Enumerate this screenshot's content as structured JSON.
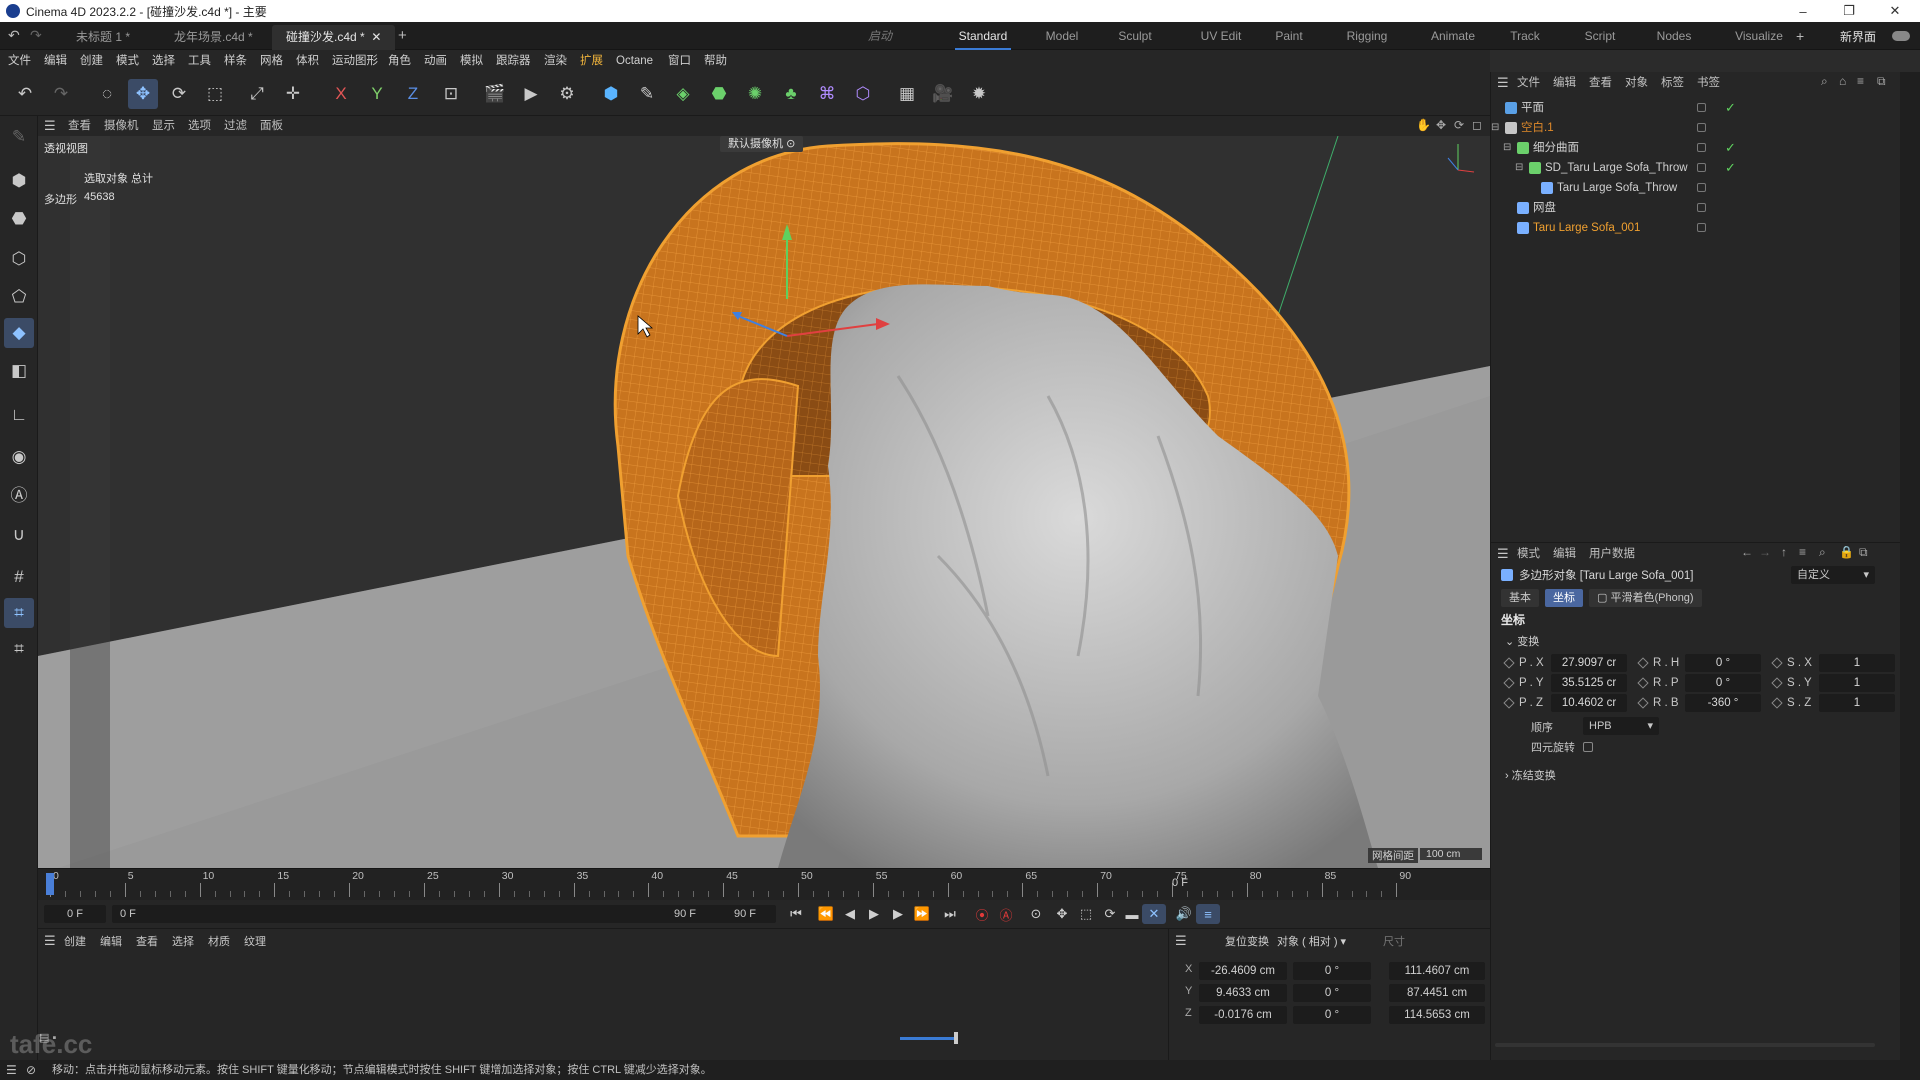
{
  "app": {
    "title": "Cinema 4D 2023.2.2 - [碰撞沙发.c4d *] - 主要"
  },
  "doc_tabs": [
    "未标题 1 *",
    "龙年场景.c4d *",
    "碰撞沙发.c4d *"
  ],
  "layout_label": "启动",
  "layouts": [
    "Standard",
    "Model",
    "Sculpt",
    "UV Edit",
    "Paint",
    "Rigging",
    "Animate",
    "Track",
    "Script",
    "Nodes",
    "Visualize"
  ],
  "layout_active": "Standard",
  "new_interface": "新界面",
  "menu": [
    "文件",
    "编辑",
    "创建",
    "模式",
    "选择",
    "工具",
    "样条",
    "网格",
    "体积",
    "运动图形",
    "角色",
    "动画",
    "模拟",
    "跟踪器",
    "渲染",
    "扩展",
    "Octane",
    "窗口",
    "帮助"
  ],
  "axis_buttons": [
    "X",
    "Y",
    "Z"
  ],
  "viewport": {
    "menu": [
      "查看",
      "摄像机",
      "显示",
      "选项",
      "过滤",
      "面板"
    ],
    "view_name": "透视视图",
    "camera": "默认摄像机",
    "stats_header": "选取对象 总计",
    "stats_label": "多边形",
    "stats_value": "45638",
    "grid_label": "网格间距",
    "grid_value": "100 cm"
  },
  "timeline": {
    "ticks": [
      "0",
      "5",
      "10",
      "15",
      "20",
      "25",
      "30",
      "35",
      "40",
      "45",
      "50",
      "55",
      "60",
      "65",
      "70",
      "75",
      "80",
      "85",
      "90"
    ],
    "current_frame": "0 F"
  },
  "transport": {
    "start_field": "0 F",
    "range_start": "0 F",
    "range_end": "90 F",
    "end_field": "90 F"
  },
  "material_menu": [
    "创建",
    "编辑",
    "查看",
    "选择",
    "材质",
    "纹理"
  ],
  "coords": {
    "reset_label": "复位变换",
    "mode": "对象 ( 相对 )",
    "size_label": "尺寸",
    "rows": [
      {
        "axis": "X",
        "pos": "-26.4609 cm",
        "rot": "0 °",
        "size": "111.4607 cm"
      },
      {
        "axis": "Y",
        "pos": "9.4633 cm",
        "rot": "0 °",
        "size": "87.4451 cm"
      },
      {
        "axis": "Z",
        "pos": "-0.0176 cm",
        "rot": "0 °",
        "size": "114.5653 cm"
      }
    ]
  },
  "object_manager": {
    "menu": [
      "文件",
      "编辑",
      "查看",
      "对象",
      "标签",
      "书签"
    ],
    "items": [
      {
        "name": "平面",
        "indent": 0,
        "color": "#d0d0d0",
        "icon": "#5aa0e6",
        "check": true
      },
      {
        "name": "空白.1",
        "indent": 0,
        "color": "#e08a2a",
        "icon": "#c6c6c6",
        "check": false
      },
      {
        "name": "细分曲面",
        "indent": 1,
        "color": "#d0d0d0",
        "icon": "#6bd06b",
        "check": true
      },
      {
        "name": "SD_Taru Large Sofa_Throw",
        "indent": 2,
        "color": "#d0d0d0",
        "icon": "#6bd06b",
        "check": true
      },
      {
        "name": "Taru Large Sofa_Throw",
        "indent": 3,
        "color": "#d0d0d0",
        "icon": "#7ab0ff",
        "check": false
      },
      {
        "name": "网盘",
        "indent": 1,
        "color": "#d0d0d0",
        "icon": "#7ab0ff",
        "check": false
      },
      {
        "name": "Taru Large Sofa_001",
        "indent": 1,
        "color": "#f0a030",
        "icon": "#7ab0ff",
        "check": false
      }
    ]
  },
  "attributes": {
    "menu": [
      "模式",
      "编辑",
      "用户数据"
    ],
    "object_title": "多边形对象 [Taru Large Sofa_001]",
    "preset": "自定义",
    "tabs": [
      "基本",
      "坐标",
      "平滑着色(Phong)"
    ],
    "active_tab": "坐标",
    "section": "坐标",
    "group": "变换",
    "pos": [
      {
        "label": "P . X",
        "value": "27.9097 cr"
      },
      {
        "label": "P . Y",
        "value": "35.5125 cr"
      },
      {
        "label": "P . Z",
        "value": "10.4602 cr"
      }
    ],
    "rot": [
      {
        "label": "R . H",
        "value": "0 °"
      },
      {
        "label": "R . P",
        "value": "0 °"
      },
      {
        "label": "R . B",
        "value": "-360 °"
      }
    ],
    "scale": [
      {
        "label": "S . X",
        "value": "1"
      },
      {
        "label": "S . Y",
        "value": "1"
      },
      {
        "label": "S . Z",
        "value": "1"
      }
    ],
    "order_label": "顺序",
    "order_value": "HPB",
    "quat_label": "四元旋转",
    "frozen_label": "冻结变换"
  },
  "status": "移动：点击并拖动鼠标移动元素。按住 SHIFT 键量化移动；节点编辑模式时按住 SHIFT 键增加选择对象；按住 CTRL 键减少选择对象。",
  "watermark": "tafe.cc",
  "colors": {
    "accent": "#3a7bd5",
    "selection_orange": "#f0a030",
    "record": "#e03a3a"
  }
}
